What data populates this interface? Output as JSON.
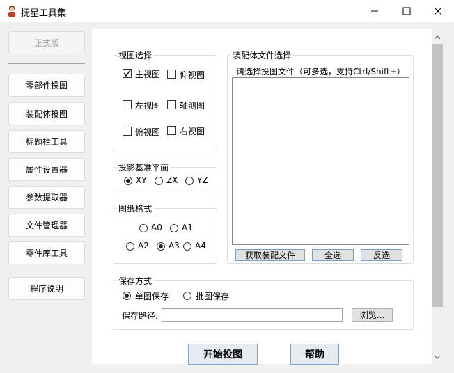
{
  "window": {
    "title": "抚星工具集",
    "minimize_glyph": "—",
    "maximize_glyph": "☐",
    "close_glyph": "✕"
  },
  "sidebar": {
    "edition": "正式版",
    "items": [
      {
        "label": "零部件投图"
      },
      {
        "label": "装配体投图"
      },
      {
        "label": "标题栏工具"
      },
      {
        "label": "属性设置器"
      },
      {
        "label": "参数提取器"
      },
      {
        "label": "文件管理器"
      },
      {
        "label": "零件库工具"
      }
    ],
    "help_label": "程序说明"
  },
  "view_select": {
    "title": "视图选择",
    "options": [
      {
        "label": "主视图",
        "checked": true
      },
      {
        "label": "仰视图",
        "checked": false
      },
      {
        "label": "左视图",
        "checked": false
      },
      {
        "label": "轴测图",
        "checked": false
      },
      {
        "label": "俯视图",
        "checked": false
      },
      {
        "label": "右视图",
        "checked": false
      }
    ]
  },
  "projection_plane": {
    "title": "投影基准平面",
    "options": [
      {
        "label": "XY",
        "selected": true
      },
      {
        "label": "ZX",
        "selected": false
      },
      {
        "label": "YZ",
        "selected": false
      }
    ]
  },
  "paper_format": {
    "title": "图纸格式",
    "options": [
      {
        "label": "A0",
        "selected": false
      },
      {
        "label": "A1",
        "selected": false
      },
      {
        "label": "A2",
        "selected": false
      },
      {
        "label": "A3",
        "selected": true
      },
      {
        "label": "A4",
        "selected": false
      }
    ]
  },
  "assembly_files": {
    "title": "装配体文件选择",
    "hint": "请选择投图文件（可多选，支持Ctrl/Shift+）",
    "get_button": "获取装配文件",
    "select_all_button": "全选",
    "invert_button": "反选"
  },
  "save_mode": {
    "title": "保存方式",
    "options": [
      {
        "label": "单图保存",
        "selected": true
      },
      {
        "label": "批图保存",
        "selected": false
      }
    ],
    "path_label": "保存路径:",
    "path_value": "",
    "browse_button": "浏览..."
  },
  "actions": {
    "start_button": "开始投图",
    "help_button": "帮助"
  }
}
